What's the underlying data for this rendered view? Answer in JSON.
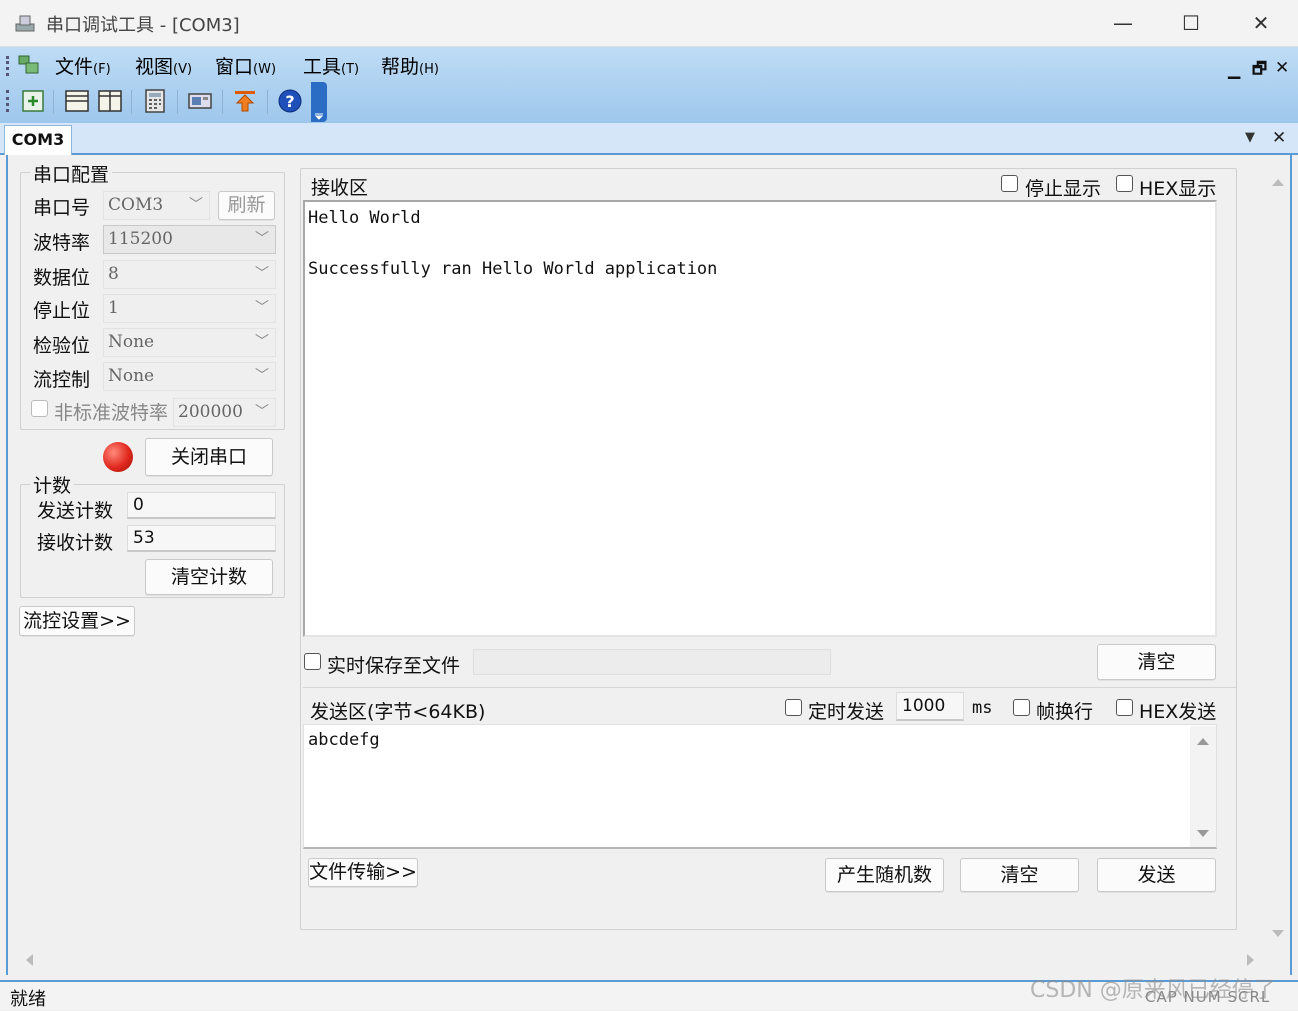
{
  "window": {
    "title": "串口调试工具 - [COM3]",
    "minimize": "—",
    "maximize": "☐",
    "close": "✕"
  },
  "menu": [
    {
      "label": "文件",
      "key": "(F)"
    },
    {
      "label": "视图",
      "key": "(V)"
    },
    {
      "label": "窗口",
      "key": "(W)"
    },
    {
      "label": "工具",
      "key": "(T)"
    },
    {
      "label": "帮助",
      "key": "(H)"
    }
  ],
  "mdi": {
    "minimize": "▁",
    "restore": "🗗",
    "close": "✕"
  },
  "tab": {
    "label": "COM3",
    "dropdown": "▼",
    "close": "✕"
  },
  "serial_config": {
    "group_title": "串口配置",
    "port_label": "串口号",
    "port_value": "COM3",
    "refresh": "刷新",
    "baud_label": "波特率",
    "baud_value": "115200",
    "databits_label": "数据位",
    "databits_value": "8",
    "stopbits_label": "停止位",
    "stopbits_value": "1",
    "parity_label": "检验位",
    "parity_value": "None",
    "flow_label": "流控制",
    "flow_value": "None",
    "nonstd_label": "非标准波特率",
    "nonstd_value": "200000",
    "close_port": "关闭串口",
    "status_color": "#e0281e"
  },
  "counter": {
    "group_title": "计数",
    "sent_label": "发送计数",
    "sent_value": "0",
    "recv_label": "接收计数",
    "recv_value": "53",
    "clear": "清空计数"
  },
  "flow_settings": "流控设置>>",
  "receive": {
    "title": "接收区",
    "stop_display": "停止显示",
    "hex_display": "HEX显示",
    "line1": "Hello World",
    "line2": "Successfully ran Hello World application",
    "save_to_file": "实时保存至文件",
    "clear": "清空"
  },
  "send": {
    "title": "发送区(字节<64KB)",
    "timed_send": "定时发送",
    "interval": "1000",
    "unit": "ms",
    "frame_newline": "帧换行",
    "hex_send": "HEX发送",
    "content": "abcdefg",
    "file_transfer": "文件传输>>",
    "random": "产生随机数",
    "clear": "清空",
    "send": "发送"
  },
  "status": {
    "ready": "就绪",
    "indicators": "CAP NUM SCRL",
    "watermark": "CSDN @原来风已经停了"
  }
}
